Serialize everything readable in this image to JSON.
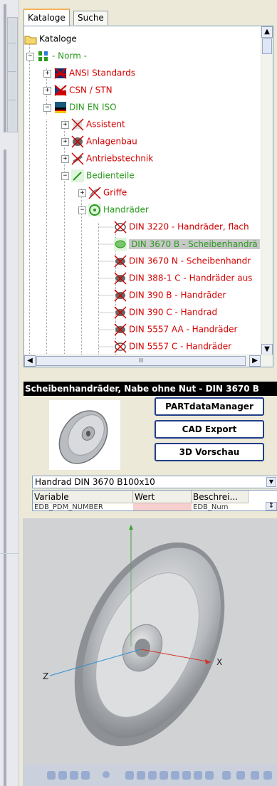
{
  "tabs": [
    {
      "label": "Kataloge",
      "active": true
    },
    {
      "label": "Suche",
      "active": false
    }
  ],
  "tree": [
    {
      "label": "Kataloge",
      "color": "#000000",
      "icon": "folder-icon"
    },
    {
      "label": "- Norm -",
      "color": "#2a9a1e",
      "icon": "norm-icon"
    },
    {
      "label": "ANSI Standards",
      "color": "#d40000",
      "icon": "ansi-flag-icon"
    },
    {
      "label": "CSN / STN",
      "color": "#d40000",
      "icon": "csn-flag-icon"
    },
    {
      "label": "DIN EN ISO",
      "color": "#2a9a1e",
      "icon": "din-flag-icon"
    },
    {
      "label": "Assistent",
      "color": "#d40000",
      "icon": "assistant-icon"
    },
    {
      "label": "Anlagenbau",
      "color": "#d40000",
      "icon": "plant-icon"
    },
    {
      "label": "Antriebstechnik",
      "color": "#d40000",
      "icon": "drive-icon"
    },
    {
      "label": "Bedienteile",
      "color": "#2a9a1e",
      "icon": "controls-icon"
    },
    {
      "label": "Griffe",
      "color": "#d40000",
      "icon": "handle-icon"
    },
    {
      "label": "Handräder",
      "color": "#2a9a1e",
      "icon": "handwheel-icon"
    },
    {
      "label": "DIN 3220 - Handräder, flach",
      "color": "#d40000",
      "icon": "part-icon"
    },
    {
      "label": "DIN 3670 B - Scheibenhandrä",
      "color": "#2a9a1e",
      "icon": "part-icon",
      "selected": true
    },
    {
      "label": "DIN 3670 N - Scheibenhandr",
      "color": "#d40000",
      "icon": "part-icon"
    },
    {
      "label": "DIN 388-1 C - Handräder aus",
      "color": "#d40000",
      "icon": "part-icon"
    },
    {
      "label": "DIN 390 B - Handräder",
      "color": "#d40000",
      "icon": "part-icon"
    },
    {
      "label": "DIN 390 C - Handrad",
      "color": "#d40000",
      "icon": "part-icon"
    },
    {
      "label": "DIN 5557 AA - Handräder",
      "color": "#d40000",
      "icon": "part-icon"
    },
    {
      "label": "DIN 5557 C - Handräder",
      "color": "#d40000",
      "icon": "part-icon"
    }
  ],
  "scrollbar": {
    "up": "▲",
    "down": "▼",
    "left": "◀",
    "right": "▶",
    "grip": "III"
  },
  "info_title": "Scheibenhandräder, Nabe ohne Nut - DIN 3670 B",
  "buttons": {
    "partdata": "PARTdataManager",
    "cad_export": "CAD Export",
    "preview3d": "3D Vorschau"
  },
  "variant": {
    "selected": "Handrad DIN 3670 B100x10",
    "dropdown_glyph": "▼"
  },
  "table": {
    "headers": [
      "Variable",
      "Wert",
      "Beschrei..."
    ],
    "row": [
      "EDB_PDM_NUMBER",
      "",
      "EDB_Num"
    ]
  },
  "axes": {
    "x": "X",
    "z": "Z"
  },
  "colors": {
    "missing": "#d40000",
    "available": "#2a9a1e",
    "button_border": "#1f3d8a",
    "tab_highlight": "#f5b25a"
  }
}
